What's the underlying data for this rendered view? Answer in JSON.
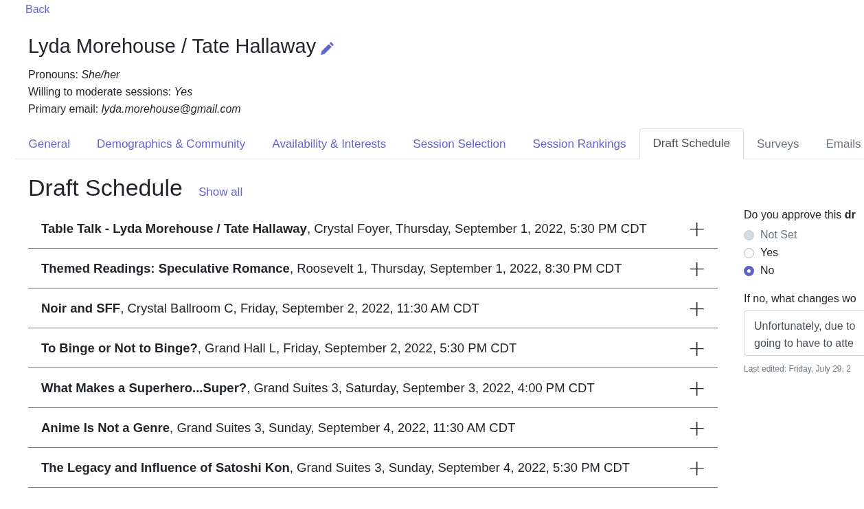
{
  "back_link": "Back",
  "person": {
    "name": "Lyda Morehouse / Tate Hallaway",
    "details": [
      {
        "label": "Pronouns:",
        "value": "She/her"
      },
      {
        "label": "Willing to moderate sessions:",
        "value": "Yes"
      },
      {
        "label": "Primary email:",
        "value": "lyda.morehouse@gmail.com"
      }
    ]
  },
  "tabs": [
    {
      "label": "General",
      "selected": false,
      "disabled": false
    },
    {
      "label": "Demographics & Community",
      "selected": false,
      "disabled": false
    },
    {
      "label": "Availability & Interests",
      "selected": false,
      "disabled": false
    },
    {
      "label": "Session Selection",
      "selected": false,
      "disabled": false
    },
    {
      "label": "Session Rankings",
      "selected": false,
      "disabled": false
    },
    {
      "label": "Draft Schedule",
      "selected": true,
      "disabled": false
    },
    {
      "label": "Surveys",
      "selected": false,
      "disabled": true
    },
    {
      "label": "Emails",
      "selected": false,
      "disabled": true
    }
  ],
  "section": {
    "title": "Draft Schedule",
    "show_all": "Show all"
  },
  "sessions": [
    {
      "title": "Table Talk - Lyda Morehouse / Tate Hallaway",
      "details": ", Crystal Foyer, Thursday, September 1, 2022, 5:30 PM CDT",
      "expand": "+"
    },
    {
      "title": "Themed Readings: Speculative Romance",
      "details": ", Roosevelt 1, Thursday, September 1, 2022, 8:30 PM CDT",
      "expand": "+"
    },
    {
      "title": "Noir and SFF",
      "details": ", Crystal Ballroom C, Friday, September 2, 2022, 11:30 AM CDT",
      "expand": "+"
    },
    {
      "title": "To Binge or Not to Binge?",
      "details": ", Grand Hall L, Friday, September 2, 2022, 5:30 PM CDT",
      "expand": "+"
    },
    {
      "title": "What Makes a Superhero...Super?",
      "details": ", Grand Suites 3, Saturday, September 3, 2022, 4:00 PM CDT",
      "expand": "+"
    },
    {
      "title": "Anime Is Not a Genre",
      "details": ", Grand Suites 3, Sunday, September 4, 2022, 11:30 AM CDT",
      "expand": "+"
    },
    {
      "title": "The Legacy and Influence of Satoshi Kon",
      "details": ", Grand Suites 3, Sunday, September 4, 2022, 5:30 PM CDT",
      "expand": "+"
    }
  ],
  "approval": {
    "question": "Do you approve this **dr**",
    "options": [
      {
        "label": "Not Set",
        "selected": false,
        "disabled": true
      },
      {
        "label": "Yes",
        "selected": false,
        "disabled": false
      },
      {
        "label": "No",
        "selected": true,
        "disabled": false
      }
    ],
    "changes_label": "If no, what changes wo",
    "changes_lines": [
      "Unfortunately, due to",
      "going to have to atte"
    ],
    "last_edited": "Last edited: Friday, July 29, 2"
  }
}
